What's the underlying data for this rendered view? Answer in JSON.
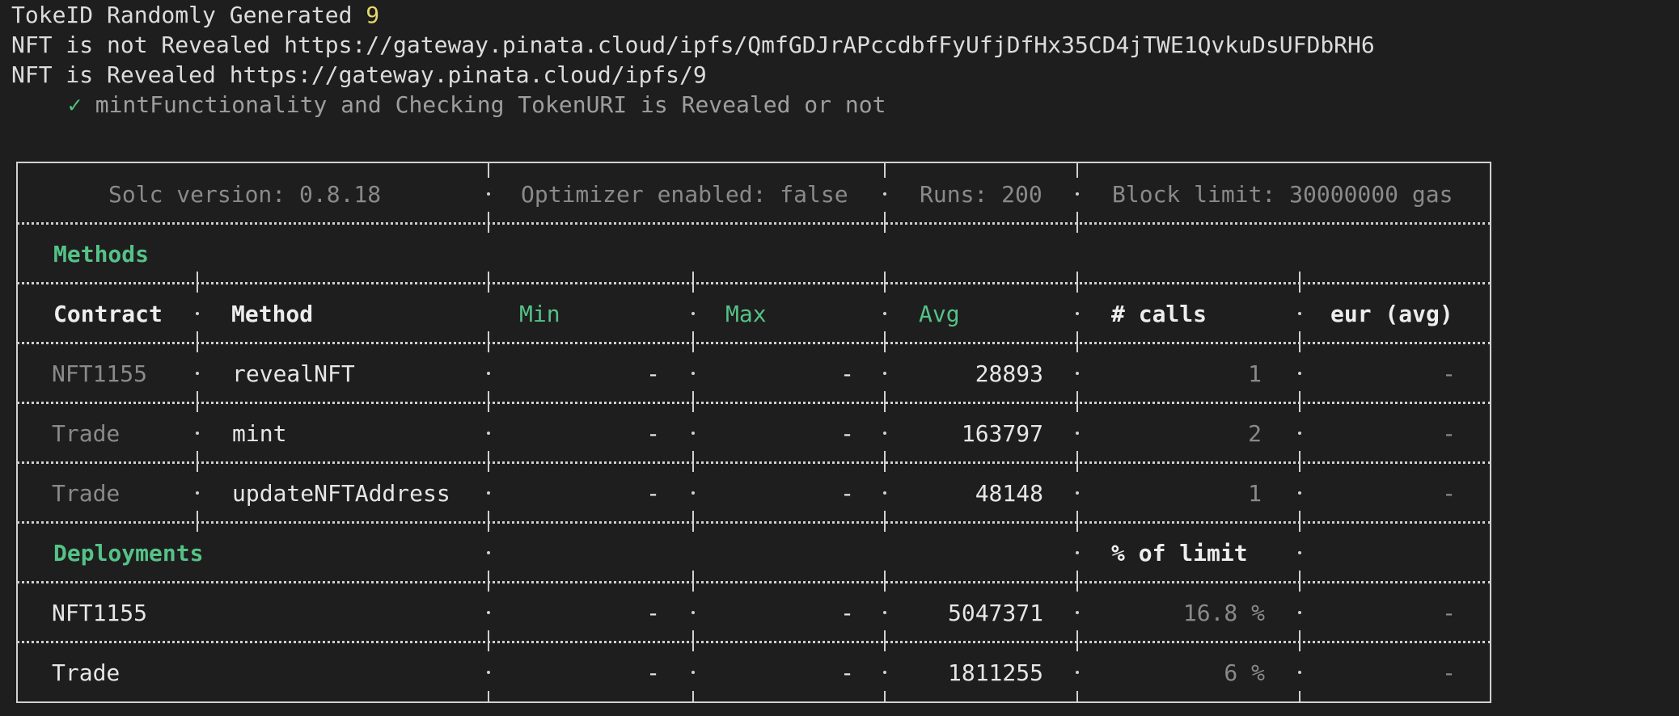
{
  "output": {
    "token_line_prefix": "TokeID Randomly Generated ",
    "token_id": "9",
    "not_revealed_line": "NFT is not Revealed https://gateway.pinata.cloud/ipfs/QmfGDJrAPccdbfFyUfjDfHx35CD4jTWE1QvkuDsUFDbRH6",
    "revealed_line": "NFT is Revealed https://gateway.pinata.cloud/ipfs/9",
    "test_check_mark": "✓",
    "test_name": "mintFunctionality and Checking TokenURI is Revealed or not"
  },
  "gas_report": {
    "header": {
      "solc": "Solc version: 0.8.18",
      "optimizer": "Optimizer enabled: false",
      "runs": "Runs: 200",
      "block_limit": "Block limit: 30000000 gas"
    },
    "methods_title": "Methods",
    "columns": {
      "contract": "Contract",
      "method": "Method",
      "min": "Min",
      "max": "Max",
      "avg": "Avg",
      "calls": "# calls",
      "eur": "eur (avg)"
    },
    "methods": [
      {
        "contract": "NFT1155",
        "method": "revealNFT",
        "min": "-",
        "max": "-",
        "avg": "28893",
        "calls": "1",
        "eur": "-"
      },
      {
        "contract": "Trade",
        "method": "mint",
        "min": "-",
        "max": "-",
        "avg": "163797",
        "calls": "2",
        "eur": "-"
      },
      {
        "contract": "Trade",
        "method": "updateNFTAddress",
        "min": "-",
        "max": "-",
        "avg": "48148",
        "calls": "1",
        "eur": "-"
      }
    ],
    "deployments_title": "Deployments",
    "percent_limit_label": "% of limit",
    "deployments": [
      {
        "contract": "NFT1155",
        "min": "-",
        "max": "-",
        "avg": "5047371",
        "percent": "16.8 %",
        "eur": "-"
      },
      {
        "contract": "Trade",
        "min": "-",
        "max": "-",
        "avg": "1811255",
        "percent": "6 %",
        "eur": "-"
      }
    ]
  }
}
